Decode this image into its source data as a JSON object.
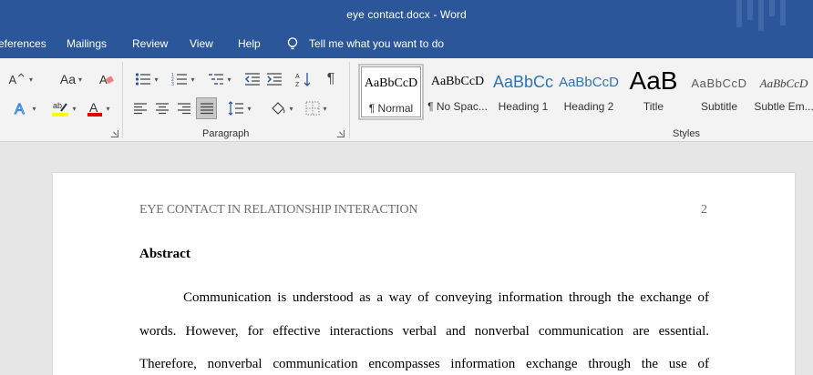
{
  "window": {
    "title": "eye contact.docx  -  Word"
  },
  "menu": {
    "tabs": [
      "eferences",
      "Mailings",
      "Review",
      "View",
      "Help"
    ],
    "tell_me": "Tell me what you want to do"
  },
  "ribbon": {
    "font": {
      "case_label": "Aa"
    },
    "paragraph": {
      "label": "Paragraph"
    },
    "styles": {
      "label": "Styles",
      "items": [
        {
          "sample": "AaBbCcD",
          "name": "¶ Normal"
        },
        {
          "sample": "AaBbCcD",
          "name": "¶ No Spac..."
        },
        {
          "sample": "AaBbCc",
          "name": "Heading 1"
        },
        {
          "sample": "AaBbCcD",
          "name": "Heading 2"
        },
        {
          "sample": "AaB",
          "name": "Title"
        },
        {
          "sample": "AaBbCcD",
          "name": "Subtitle"
        },
        {
          "sample": "AaBbCcD",
          "name": "Subtle Em..."
        }
      ]
    },
    "colors": {
      "accent": "#2b579a",
      "highlight": "#ffff00",
      "font_color": "#e00000"
    }
  },
  "document": {
    "running_head": "EYE CONTACT IN RELATIONSHIP INTERACTION",
    "page_number": "2",
    "heading": "Abstract",
    "lines": [
      "Communication is understood as a way of conveying information through the exchange of",
      "words. However, for effective interactions verbal and nonverbal communication are essential.",
      "Therefore, nonverbal communication encompasses information exchange through the use of"
    ]
  }
}
